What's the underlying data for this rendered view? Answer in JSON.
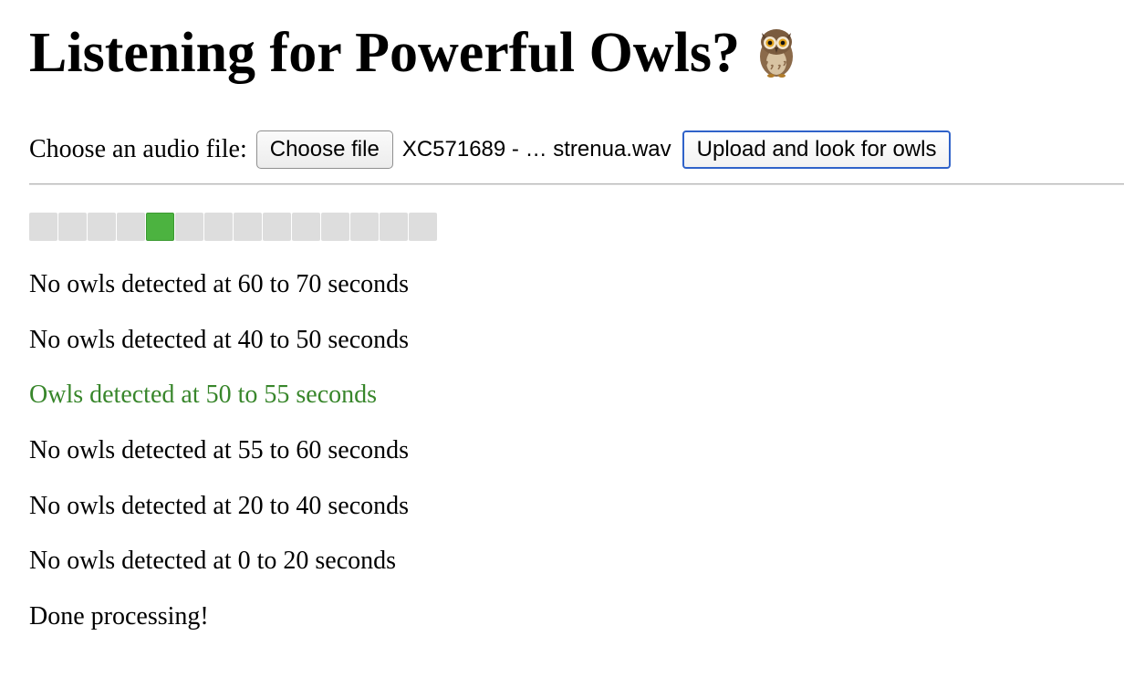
{
  "page": {
    "title": "Listening for Powerful Owls?",
    "title_icon": "owl-icon"
  },
  "form": {
    "label": "Choose an audio file:",
    "choose_button": "Choose file",
    "file_name": "XC571689 - … strenua.wav",
    "upload_button": "Upload and look for owls"
  },
  "progress": {
    "segment_count": 14,
    "active_segment_index": 4,
    "inactive_color": "#dddddd",
    "active_color": "#4cb340"
  },
  "results": [
    {
      "text": "No owls detected at 60 to 70 seconds",
      "detected": false
    },
    {
      "text": "No owls detected at 40 to 50 seconds",
      "detected": false
    },
    {
      "text": "Owls detected at 50 to 55 seconds",
      "detected": true
    },
    {
      "text": "No owls detected at 55 to 60 seconds",
      "detected": false
    },
    {
      "text": "No owls detected at 20 to 40 seconds",
      "detected": false
    },
    {
      "text": "No owls detected at 0 to 20 seconds",
      "detected": false
    },
    {
      "text": "Done processing!",
      "detected": false
    }
  ],
  "colors": {
    "detected_text": "#38862b",
    "upload_button_border": "#2f62c9"
  }
}
